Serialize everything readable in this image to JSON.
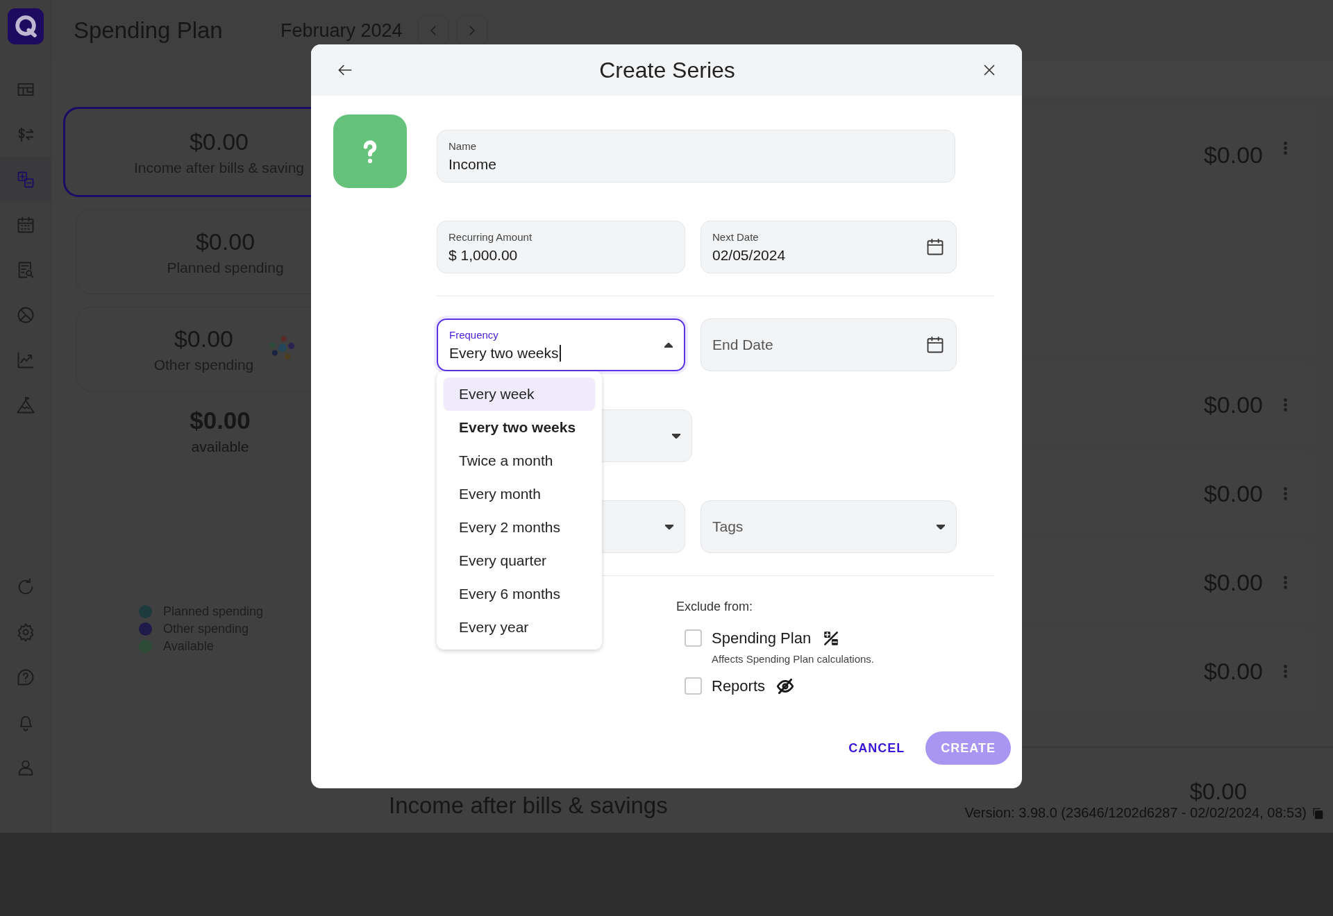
{
  "sidebar": {
    "top": [
      {
        "kind": "grid",
        "selected": false
      },
      {
        "kind": "transfer",
        "selected": false
      },
      {
        "kind": "plan",
        "selected": true
      },
      {
        "kind": "calendar",
        "selected": false
      },
      {
        "kind": "report",
        "selected": false
      },
      {
        "kind": "pie",
        "selected": false
      },
      {
        "kind": "trend",
        "selected": false
      },
      {
        "kind": "mountain",
        "selected": false
      }
    ],
    "bottom": [
      {
        "kind": "refresh",
        "selected": false
      },
      {
        "kind": "gear",
        "selected": false
      },
      {
        "kind": "help",
        "selected": false
      },
      {
        "kind": "bell",
        "selected": false
      },
      {
        "kind": "person",
        "selected": false
      }
    ]
  },
  "header": {
    "title": "Spending Plan",
    "month": "February 2024"
  },
  "summary_cards": [
    {
      "amount": "$0.00",
      "label": "Income after bills & saving",
      "selected": true,
      "kind": "plain"
    },
    {
      "amount": "$0.00",
      "label": "Planned spending",
      "selected": false,
      "kind": "plain"
    },
    {
      "amount": "$0.00",
      "label": "Other spending",
      "selected": false,
      "kind": "bubbles"
    }
  ],
  "available": {
    "amount": "$0.00",
    "label": "available"
  },
  "legend": [
    {
      "label": "Planned spending",
      "color": "#1e3a3c"
    },
    {
      "label": "Other spending",
      "color": "#1f1a4a"
    },
    {
      "label": "Available",
      "color": "#2c4a35"
    }
  ],
  "series_rows": [
    {
      "amount": "$0.00"
    },
    {
      "amount": "$0.00"
    },
    {
      "amount": "$0.00"
    },
    {
      "amount": "$0.00"
    },
    {
      "amount": "$0.00"
    }
  ],
  "footer": {
    "label": "Income after bills & savings",
    "amount": "$0.00",
    "version": "Version: 3.98.0 (23646/1202d6287 - 02/02/2024, 08:53)"
  },
  "dialog": {
    "title": "Create Series",
    "name": {
      "label": "Name",
      "value": "Income"
    },
    "recurring_amount": {
      "label": "Recurring Amount",
      "value": "$ 1,000.00"
    },
    "next_date": {
      "label": "Next Date",
      "value": "02/05/2024"
    },
    "frequency": {
      "label": "Frequency",
      "value": "Every two weeks",
      "focused": true,
      "expanded": true,
      "options": [
        {
          "label": "Every week",
          "highlighted": true,
          "selected": false
        },
        {
          "label": "Every two weeks",
          "highlighted": false,
          "selected": true
        },
        {
          "label": "Twice a month",
          "highlighted": false,
          "selected": false
        },
        {
          "label": "Every month",
          "highlighted": false,
          "selected": false
        },
        {
          "label": "Every 2 months",
          "highlighted": false,
          "selected": false
        },
        {
          "label": "Every quarter",
          "highlighted": false,
          "selected": false
        },
        {
          "label": "Every 6 months",
          "highlighted": false,
          "selected": false
        },
        {
          "label": "Every year",
          "highlighted": false,
          "selected": false
        }
      ]
    },
    "end_date": {
      "placeholder": "End Date"
    },
    "tags": {
      "placeholder": "Tags"
    },
    "exclude": {
      "label": "Exclude from:",
      "options": [
        {
          "label": "Spending Plan",
          "checked": false,
          "kind": "plan",
          "note": "Affects Spending Plan calculations."
        },
        {
          "label": "Reports",
          "checked": false,
          "kind": "hidden"
        }
      ]
    },
    "cancel": {
      "label": "CANCEL"
    },
    "create": {
      "label": "CREATE",
      "disabled": true
    }
  }
}
